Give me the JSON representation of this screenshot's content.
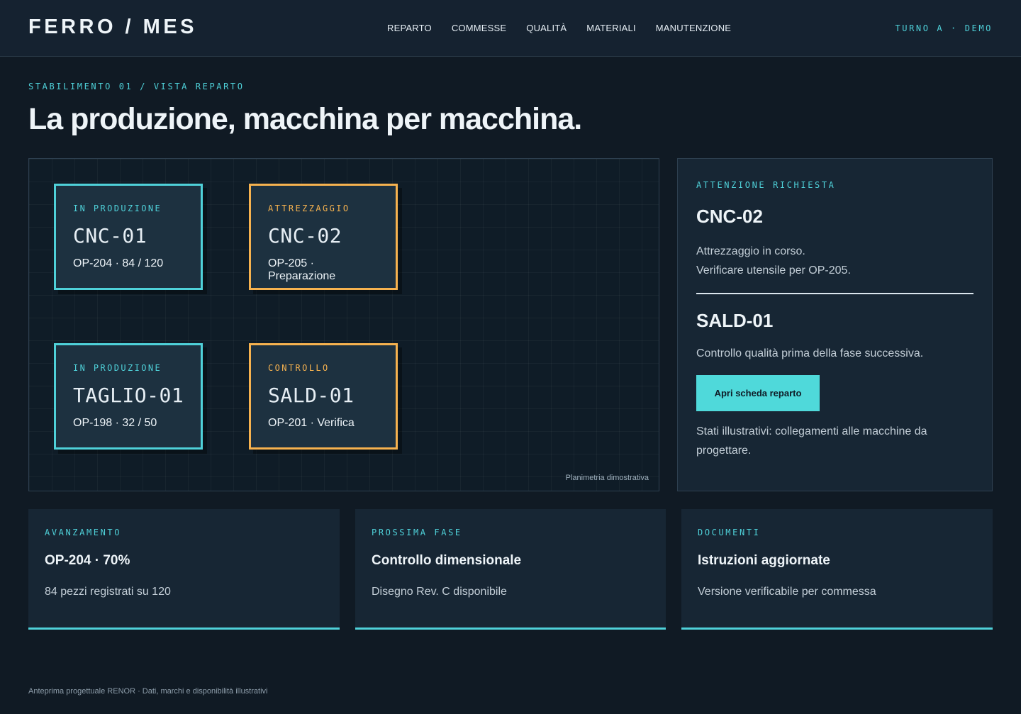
{
  "header": {
    "logo": "FERRO / MES",
    "nav": [
      "REPARTO",
      "COMMESSE",
      "QUALITÀ",
      "MATERIALI",
      "MANUTENZIONE"
    ],
    "shift": "TURNO A · DEMO"
  },
  "hero": {
    "eyebrow": "STABILIMENTO 01 / VISTA REPARTO",
    "title": "La produzione, macchina per macchina."
  },
  "floorplan": {
    "machines": [
      {
        "status": "IN PRODUZIONE",
        "name": "CNC-01",
        "info": "OP-204 · 84 / 120"
      },
      {
        "status": "ATTREZZAGGIO",
        "name": "CNC-02",
        "info": "OP-205 · Preparazione"
      },
      {
        "status": "IN PRODUZIONE",
        "name": "TAGLIO-01",
        "info": "OP-198 · 32 / 50"
      },
      {
        "status": "CONTROLLO",
        "name": "SALD-01",
        "info": "OP-201 · Verifica"
      }
    ],
    "caption": "Planimetria dimostrativa"
  },
  "alert": {
    "eyebrow": "ATTENZIONE RICHIESTA",
    "machine1": "CNC-02",
    "line1": "Attrezzaggio in corso.",
    "line2": "Verificare utensile per OP-205.",
    "machine2": "SALD-01",
    "line3": "Controllo qualità prima della fase successiva.",
    "button": "Apri scheda reparto",
    "note": "Stati illustrativi: collegamenti alle macchine da progettare."
  },
  "cards": [
    {
      "eyebrow": "AVANZAMENTO",
      "title": "OP-204 · 70%",
      "text": "84 pezzi registrati su 120"
    },
    {
      "eyebrow": "PROSSIMA FASE",
      "title": "Controllo dimensionale",
      "text": "Disegno Rev. C disponibile"
    },
    {
      "eyebrow": "DOCUMENTI",
      "title": "Istruzioni aggiornate",
      "text": "Versione verificabile per commessa"
    }
  ],
  "footer": "Anteprima progettuale RENOR · Dati, marchi e disponibilità illustrativi",
  "colors": {
    "accent": "#4fd1d9",
    "warning": "#f6b24f",
    "background": "#101a24",
    "panel": "#172634"
  }
}
